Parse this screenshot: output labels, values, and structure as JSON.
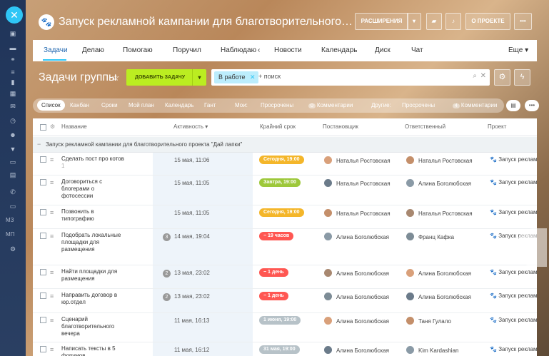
{
  "header": {
    "title": "Запуск рекламной кампании для благотворительного проекта \"Дай лапки\"",
    "extensions_label": "РАСШИРЕНИЯ",
    "about_label": "О ПРОЕКТЕ",
    "more_label": "•••"
  },
  "tabs": {
    "items": [
      "Задачи",
      "Делаю",
      "Помогаю",
      "Поручил",
      "Наблюдаю",
      "Новости",
      "Календарь",
      "Диск",
      "Чат"
    ],
    "more": "Еще ▾",
    "arrow": "‹"
  },
  "group": {
    "title": "Задачи группы",
    "add_task_label": "ДОБАВИТЬ ЗАДАЧУ"
  },
  "search": {
    "filter_chip": "В работе",
    "placeholder": "+ поиск"
  },
  "views": {
    "items": [
      "Список",
      "Канбан",
      "Сроки",
      "Мой план",
      "Календарь",
      "Гант"
    ],
    "active": "Список",
    "my_label": "Мои:",
    "counters": [
      {
        "num": "",
        "label": "Просрочены"
      },
      {
        "num": "0",
        "label": "Комментарии"
      },
      {
        "num": "",
        "label": "Другие:"
      },
      {
        "num": "",
        "label": "Просрочены"
      },
      {
        "num": "4",
        "label": "Комментарии"
      }
    ]
  },
  "table": {
    "columns": [
      "Название",
      "Активность ▾",
      "Крайний срок",
      "Постановщик",
      "Ответственный",
      "Проект"
    ],
    "group_row": "Запуск рекламной кампании для благотворительного проекта \"Дай лапки\"",
    "rows": [
      {
        "name": "Сделать пост про котов",
        "sub": "1",
        "badge": "",
        "date": "15 мая, 11:06",
        "deadline": "Сегодня, 19:00",
        "deadline_color": "#f4b62a",
        "creator": "Наталья Ростовская",
        "responsible": "Наталья Ростовская",
        "project": "Запуск реклам"
      },
      {
        "name": "Договориться с блогерами о фотосессии",
        "sub": "",
        "badge": "",
        "date": "15 мая, 11:05",
        "deadline": "Завтра, 19:00",
        "deadline_color": "#9dc83a",
        "creator": "Наталья Ростовская",
        "responsible": "Алина Боголюбская",
        "project": "Запуск реклам"
      },
      {
        "name": "Позвонить в типографию",
        "sub": "",
        "badge": "",
        "date": "15 мая, 11:05",
        "deadline": "Сегодня, 19:00",
        "deadline_color": "#f4b62a",
        "creator": "Наталья Ростовская",
        "responsible": "Наталья Ростовская",
        "project": "Запуск реклам"
      },
      {
        "name": "Подобрать локальные площадки для размещения",
        "sub": "",
        "badge": "3",
        "date": "14 мая, 19:04",
        "deadline": "− 19 часов",
        "deadline_color": "#ff5752",
        "creator": "Алина Боголюбская",
        "responsible": "Франц Кафка",
        "project": "Запуск реклам"
      },
      {
        "name": "Найти площадки для размещения",
        "sub": "",
        "badge": "2",
        "date": "13 мая, 23:02",
        "deadline": "− 1 день",
        "deadline_color": "#ff5752",
        "creator": "Алина Боголюбская",
        "responsible": "Алина Боголюбская",
        "project": "Запуск реклам"
      },
      {
        "name": "Направить договор в юр.отдел",
        "sub": "",
        "badge": "2",
        "date": "13 мая, 23:02",
        "deadline": "− 1 день",
        "deadline_color": "#ff5752",
        "creator": "Алина Боголюбская",
        "responsible": "Алина Боголюбская",
        "project": "Запуск реклам"
      },
      {
        "name": "Сценарий благотворительного вечера",
        "sub": "",
        "badge": "",
        "date": "11 мая, 16:13",
        "deadline": "1 июня, 19:00",
        "deadline_color": "#b7c2c8",
        "creator": "Алина Боголюбская",
        "responsible": "Таня Гулало",
        "project": "Запуск реклам"
      },
      {
        "name": "Написать тексты в 5 форумов",
        "sub": "",
        "badge": "",
        "date": "11 мая, 16:12",
        "deadline": "31 мая, 19:00",
        "deadline_color": "#b7c2c8",
        "creator": "Алина Боголюбская",
        "responsible": "Kim Kardashian",
        "project": "Запуск реклам"
      }
    ]
  },
  "sidebar": {
    "labels": [
      "МЗ",
      "МП"
    ]
  }
}
